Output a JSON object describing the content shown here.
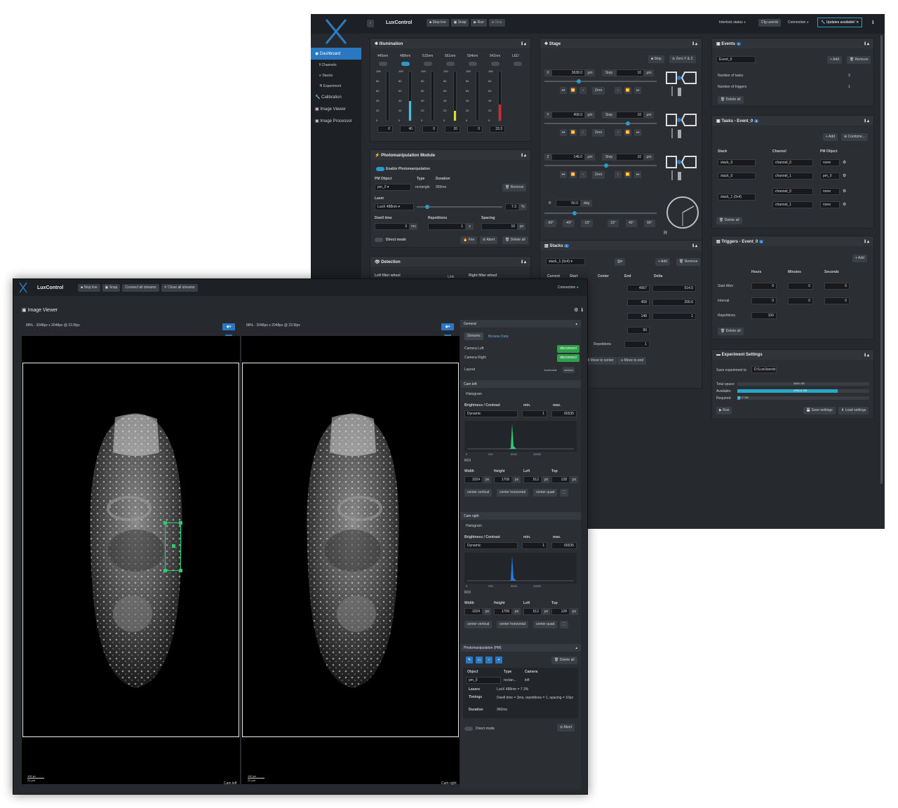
{
  "back": {
    "app_title": "LuxControl",
    "toolbar": [
      "Stop live",
      "Snap",
      "Run",
      "Stop"
    ],
    "status": {
      "interlock": "Interlock status",
      "cfg": "Cfg userdo",
      "connection": "Connection",
      "updates": "Updates available!"
    },
    "sidebar": [
      "Dashboard",
      "Channels",
      "Stacks",
      "Experiment",
      "Calibration",
      "Image Viewer",
      "Image Processor"
    ],
    "illumination": {
      "title": "Illumination",
      "lasers": [
        {
          "name": "445nm",
          "value": "0",
          "level": 0,
          "color": "#2a9bc9",
          "on": false
        },
        {
          "name": "488nm",
          "value": "40",
          "level": 0.4,
          "color": "#42c1e0",
          "on": true
        },
        {
          "name": "515nm",
          "value": "0",
          "level": 0,
          "color": "#2a9bc9",
          "on": false
        },
        {
          "name": "561nm",
          "value": "20",
          "level": 0.2,
          "color": "#d9e022",
          "on": false
        },
        {
          "name": "594nm",
          "value": "0",
          "level": 0,
          "color": "#2a9bc9",
          "on": false
        },
        {
          "name": "642nm",
          "value": "33.3",
          "level": 0.333,
          "color": "#e2262c",
          "on": false
        },
        {
          "name": "LED",
          "value": "",
          "level": 0,
          "color": "#2a9bc9",
          "on": false
        }
      ],
      "scale": [
        "100",
        "80",
        "60",
        "40",
        "20",
        "0"
      ]
    },
    "pm": {
      "title": "Photomanipulation Module",
      "enable": "Enable Photomanipulation",
      "h_object": "PM Object",
      "h_type": "Type",
      "h_duration": "Duration",
      "object": "pm_0",
      "type": "rectangle",
      "duration": "955ms",
      "remove": "Remove",
      "laser_label": "Laser",
      "laser": "LuxX 488nm",
      "laser_val": "7.3",
      "laser_unit": "%",
      "dwell_label": "Dwell time",
      "dwell": "3",
      "dwell_unit": "ms",
      "rep_label": "Repetitions",
      "rep": "1",
      "rep_unit": "x",
      "spacing_label": "Spacing",
      "spacing": "10",
      "spacing_unit": "px",
      "direct": "Direct mode",
      "fire": "Fire",
      "abort": "Abort",
      "delete_all": "Delete all"
    },
    "detection": {
      "title": "Detection",
      "left": "Left filter wheel",
      "link": "Link",
      "right": "Right filter wheel"
    },
    "stage": {
      "title": "Stage",
      "stop": "Stop",
      "zero_yz": "Zero Y & Z",
      "axes": [
        {
          "axis": "X",
          "value": "3638.0",
          "unit": "µm",
          "step": "10",
          "step_unit": "µm",
          "pos": 0.3
        },
        {
          "axis": "Y",
          "value": "458.0",
          "unit": "µm",
          "step": "10",
          "step_unit": "µm",
          "pos": 0.75
        },
        {
          "axis": "Z",
          "value": "148.0",
          "unit": "µm",
          "step": "10",
          "step_unit": "µm",
          "pos": 0.55
        }
      ],
      "step_label": "Step",
      "zero": "Zero",
      "r_axis": "R",
      "r_value": "50.0",
      "r_unit": "deg",
      "rot": [
        "-90°",
        "-45°",
        "-15°",
        "15°",
        "45°",
        "90°"
      ]
    },
    "stacks": {
      "title": "Stacks",
      "add": "Add",
      "remove": "Remove",
      "stack": "stack_1 (3x4)",
      "cols": [
        "Current",
        "Start",
        "Center",
        "End",
        "Delta"
      ],
      "end": [
        "4067",
        "458",
        "148"
      ],
      "delta": [
        "514.5",
        "200.6",
        "1"
      ],
      "extra1": "90",
      "rep_label": "Repetitions",
      "rep": "1",
      "move_center": "Move to center",
      "move_end": "Move to end"
    },
    "events": {
      "title": "Events",
      "badge": "1",
      "event": "Event_0",
      "add": "Add",
      "remove": "Remove",
      "n_tasks_label": "Number of tasks",
      "n_tasks": "3",
      "n_trig_label": "Number of triggers",
      "n_trig": "1",
      "delete_all": "Delete all"
    },
    "tasks": {
      "title": "Tasks - Event_0",
      "badge": "3",
      "add": "Add",
      "combine": "Combine...",
      "cols": [
        "Stack",
        "Channel",
        "PM Object"
      ],
      "rows": [
        {
          "stack": "stack_0",
          "channel": "channel_0",
          "pm": "none"
        },
        {
          "stack": "stack_0",
          "channel": "channel_1",
          "pm": "pm_0"
        },
        {
          "stack": "stack_1 (3x4)",
          "channel": "channel_0",
          "pm": "none"
        },
        {
          "stack": "",
          "channel": "channel_1",
          "pm": "none"
        }
      ],
      "delete_all": "Delete all"
    },
    "triggers": {
      "title": "Triggers - Event_0",
      "badge": "1",
      "add": "Add",
      "cols": [
        "Hours",
        "Minutes",
        "Seconds"
      ],
      "start_label": "Start After",
      "start": [
        "0",
        "0",
        "0"
      ],
      "interval_label": "Interval",
      "interval": [
        "0",
        "0",
        "0"
      ],
      "rep_label": "Repetitions",
      "rep": "100",
      "delete_all": "Delete all"
    },
    "settings": {
      "title": "Experiment Settings",
      "save_label": "Save experiment to",
      "save_path": "D:\\LuxUserdo",
      "total_label": "Total space:",
      "total": "3884 GB",
      "total_frac": 1,
      "avail_label": "Available:",
      "avail": "2964.8 GB",
      "avail_frac": 0.76,
      "req_label": "Required:",
      "req": "99.2 GB",
      "req_frac": 0.02,
      "run": "Run",
      "save": "Save settings",
      "load": "Load settings"
    }
  },
  "front": {
    "app_title": "LuxControl",
    "toolbar": [
      "Stop live",
      "Snap",
      "Connect all streams",
      "Close all streams"
    ],
    "connection": "Connection",
    "viewer_title": "Image Viewer",
    "left_info": "88% - 2048px x 2048px @ 23.5fps",
    "right_info": "88% - 2048px x 2048px @ 23.5fps",
    "cam_left": "Cam left",
    "cam_right": "Cam right",
    "scale_px": "100 px",
    "scale_um": "20 µm",
    "general": {
      "title": "General",
      "tab_streams": "Streams",
      "tab_browse": "Browse Data",
      "cam_left_label": "Camera Left",
      "cam_left_state": "disconnect",
      "cam_right_label": "Camera Right",
      "cam_right_state": "disconnect",
      "layout_label": "Layout",
      "layout_h": "horizontal",
      "layout_v": "vertical"
    },
    "cams": [
      {
        "title": "Cam left",
        "histogram": "Histogram",
        "bc_label": "Brightness / Contrast",
        "mode": "Dynamic",
        "min_label": "min.",
        "min": "1",
        "max_label": "max.",
        "max": "65535",
        "ticks": [
          "0",
          "200",
          "5000",
          "10000"
        ],
        "hist_color": "#2ecc71",
        "roi": "ROI",
        "w_label": "Width",
        "w": "1024",
        "h_label": "Height",
        "h": "1708",
        "l_label": "Left",
        "l": "512",
        "t_label": "Top",
        "t": "128",
        "px": "px",
        "cv": "center vertical",
        "ch": "center horizontal",
        "cq": "center quad"
      },
      {
        "title": "Cam right",
        "histogram": "Histogram",
        "bc_label": "Brightness / Contrast",
        "mode": "Dynamic",
        "min_label": "min.",
        "min": "1",
        "max_label": "max.",
        "max": "65535",
        "ticks": [
          "0",
          "200",
          "5000",
          "10000"
        ],
        "hist_color": "#2a78e0",
        "roi": "ROI",
        "w_label": "Width",
        "w": "1024",
        "h_label": "Height",
        "h": "1708",
        "l_label": "Left",
        "l": "512",
        "t_label": "Top",
        "t": "128",
        "px": "px",
        "cv": "center vertical",
        "ch": "center horizontal",
        "cq": "center quad"
      }
    ],
    "pmpanel": {
      "title": "Photomanipulation (PM)",
      "delete_all": "Delete all",
      "cols": [
        "Object",
        "Type",
        "Camera"
      ],
      "object": "pm_0",
      "type": "rectan...",
      "camera": "left",
      "lasers_label": "Lasers",
      "lasers": "LuxX 488nm = 7.3%",
      "timings_label": "Timings",
      "timings": "Dwell time = 3ms, repetitions = 1, spacing = 10px",
      "duration_label": "Duration",
      "duration": "960ms",
      "direct": "Direct mode",
      "abort": "Abort"
    }
  }
}
